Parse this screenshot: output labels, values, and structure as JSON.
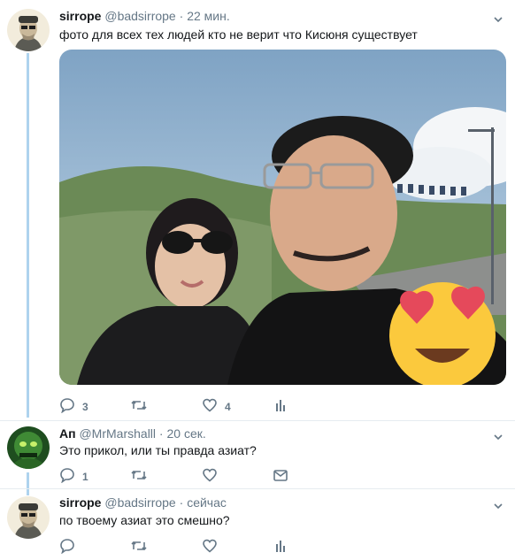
{
  "tweets": [
    {
      "name": "sirrope",
      "handle": "@badsirrope",
      "separator": "·",
      "time": "22 мин.",
      "text": "фото для всех тех людей кто не верит что Кисюня существует",
      "reply_count": "3",
      "retweet_count": "",
      "like_count": "4"
    },
    {
      "name": "Ап",
      "handle": "@MrMarshalll",
      "separator": "·",
      "time": "20 сек.",
      "text": "Это прикол, или ты правда азиат?",
      "reply_count": "1",
      "retweet_count": "",
      "like_count": ""
    },
    {
      "name": "sirrope",
      "handle": "@badsirrope",
      "separator": "·",
      "time": "сейчас",
      "text": "по твоему азиат это смешно?",
      "reply_count": "",
      "retweet_count": "",
      "like_count": ""
    }
  ],
  "colors": {
    "thread_line": "#aed3ee",
    "muted": "#657786",
    "divider": "#e6ecf0"
  },
  "icons": [
    "reply-icon",
    "retweet-icon",
    "like-icon",
    "analytics-icon",
    "message-icon",
    "chevron-down-icon"
  ]
}
